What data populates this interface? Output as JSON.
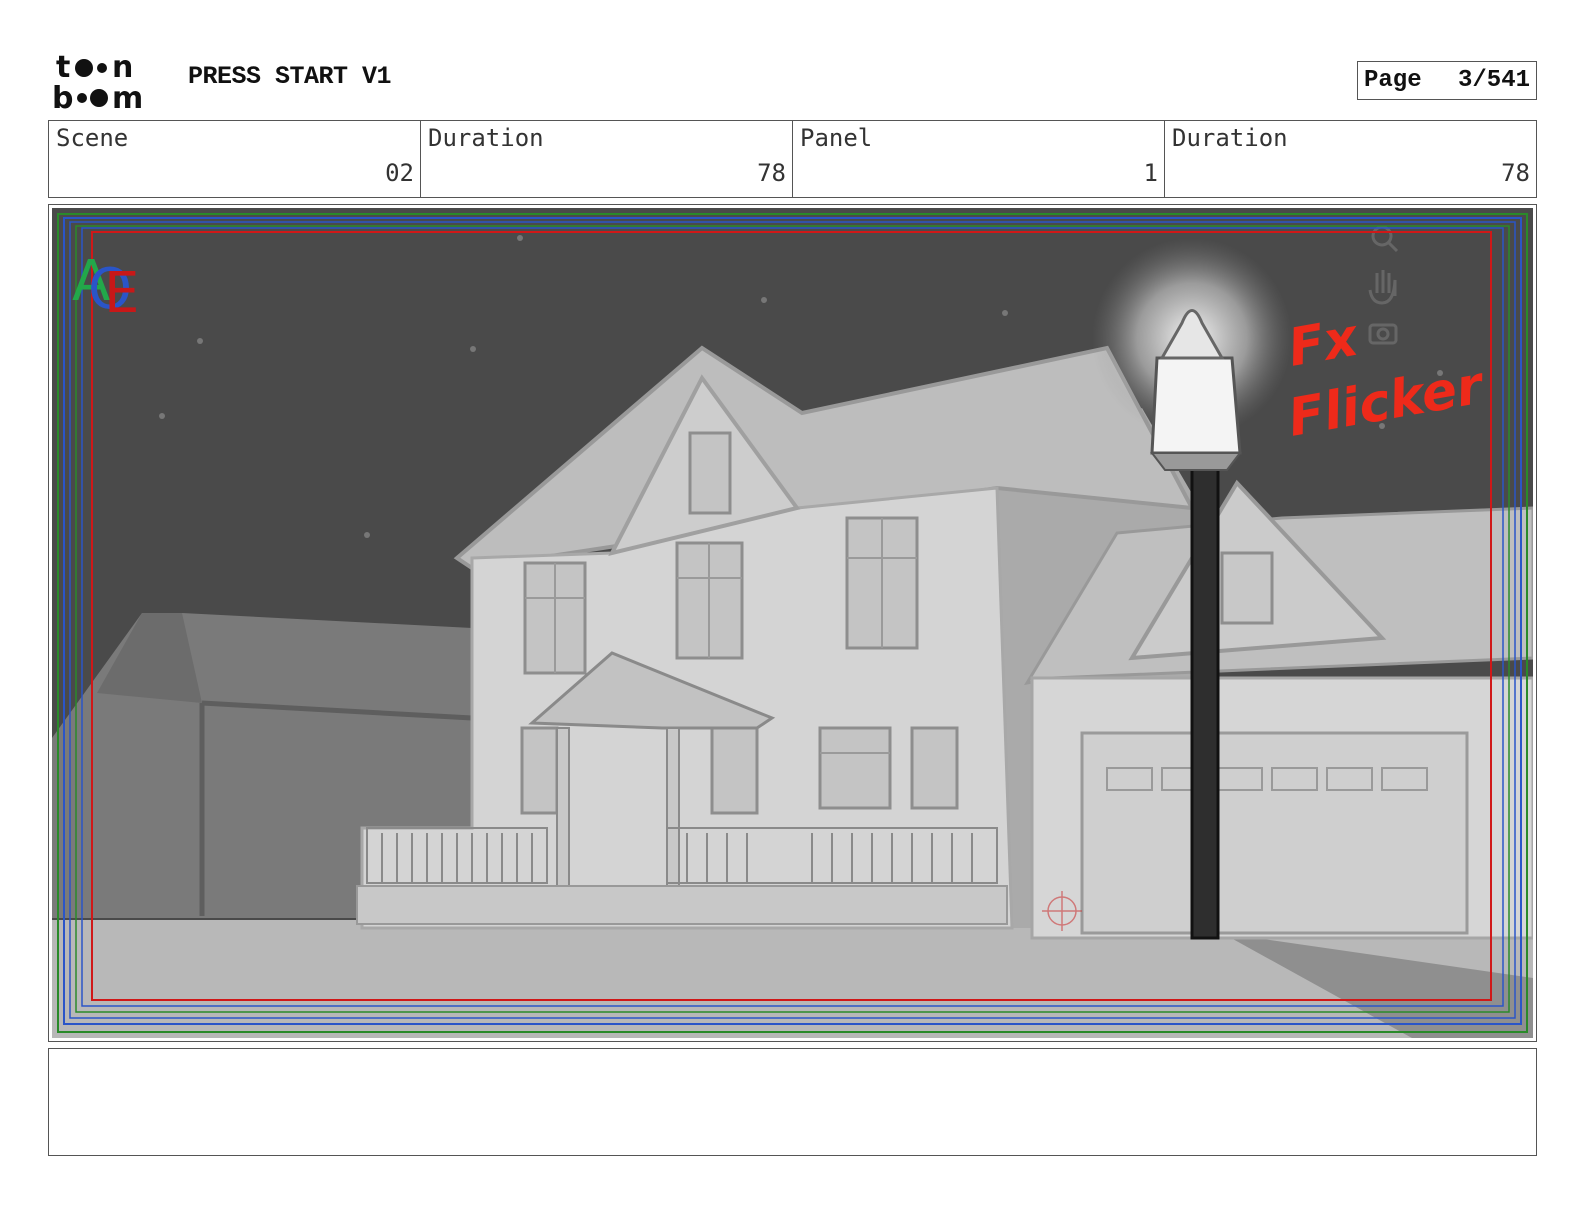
{
  "header": {
    "logo_alt": "toon boom",
    "project_title": "PRESS START V1",
    "page_label": "Page",
    "page_number": "3/541"
  },
  "info": [
    {
      "label": "Scene",
      "value": "02"
    },
    {
      "label": "Duration",
      "value": "78"
    },
    {
      "label": "Panel",
      "value": "1"
    },
    {
      "label": "Duration",
      "value": "78"
    }
  ],
  "panel": {
    "annotation_line1": "Fx",
    "annotation_line2": "Flicker",
    "annotation_color": "#ee2a1a",
    "sky_color": "#4a4a4a",
    "house_color": "#d4d4d4",
    "safe_frame_colors": [
      "#d01818",
      "#2a55c8",
      "#2a8a2a"
    ],
    "toolbar_icons": [
      "zoom-icon",
      "hand-icon",
      "camera-icon"
    ]
  },
  "notes": {
    "text": ""
  }
}
